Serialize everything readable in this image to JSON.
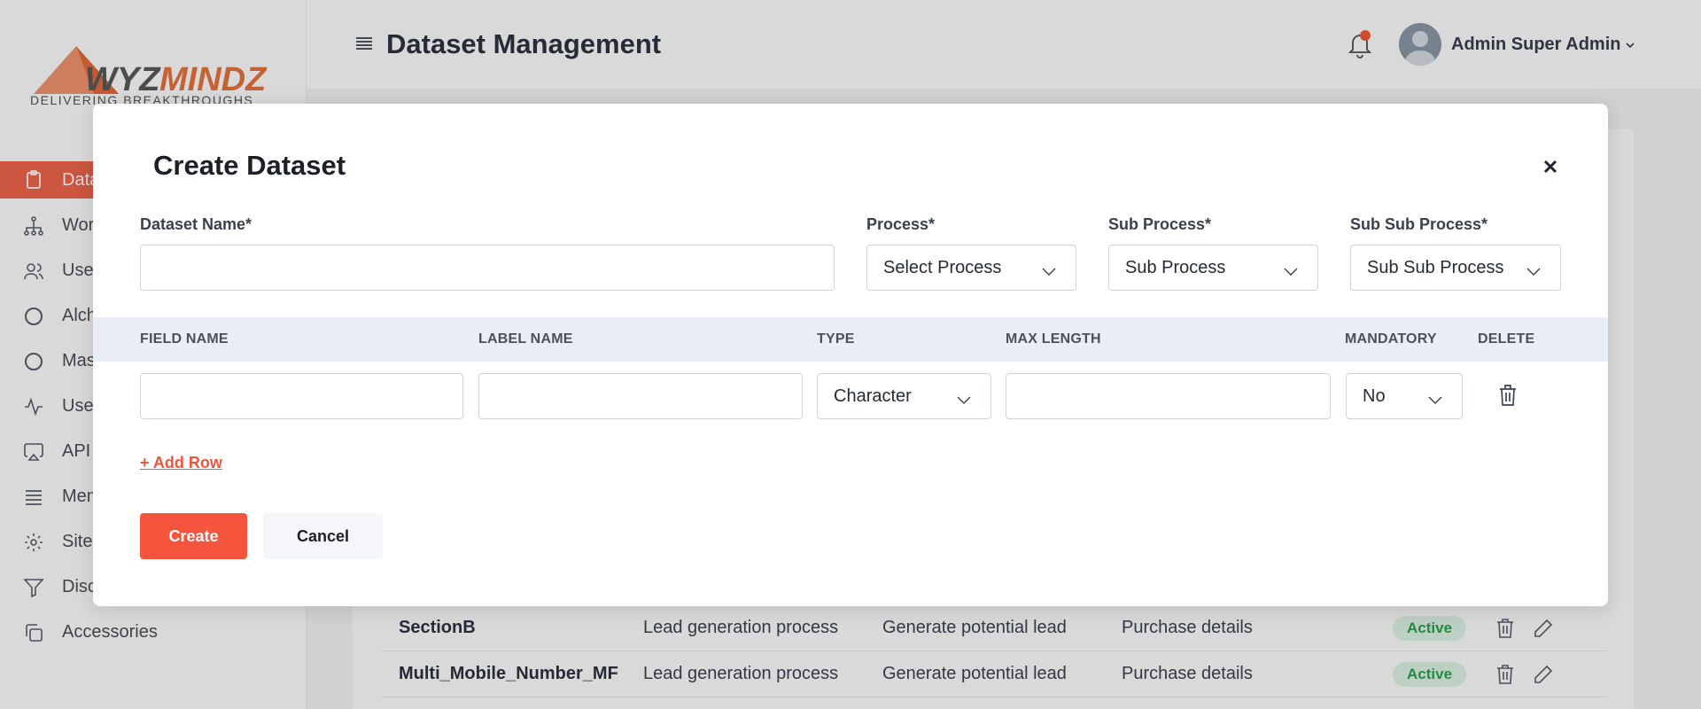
{
  "logo": {
    "wordmark_dark": "WYZ",
    "wordmark_accent": "MINDZ",
    "tagline": "DELIVERING BREAKTHROUGHS"
  },
  "sidebar": {
    "items": [
      {
        "label": "Datasets",
        "icon": "clipboard-icon",
        "active": true
      },
      {
        "label": "Workflows",
        "icon": "hierarchy-icon"
      },
      {
        "label": "Users",
        "icon": "users-icon"
      },
      {
        "label": "Alchemy",
        "icon": "circle-icon"
      },
      {
        "label": "Masters",
        "icon": "circle-icon"
      },
      {
        "label": "User Activity",
        "icon": "activity-icon"
      },
      {
        "label": "API",
        "icon": "airplay-icon"
      },
      {
        "label": "Menus",
        "icon": "list-icon"
      },
      {
        "label": "Site Settings",
        "icon": "gear-icon"
      },
      {
        "label": "Discovery",
        "icon": "filter-icon"
      },
      {
        "label": "Accessories",
        "icon": "copy-icon"
      }
    ]
  },
  "header": {
    "title": "Dataset Management",
    "user_name": "Admin Super Admin"
  },
  "background_table": {
    "rows": [
      {
        "name": "SectionB",
        "process": "Lead generation process",
        "sub_process": "Generate potential lead",
        "sub_sub_process": "Purchase details",
        "status": "Active"
      },
      {
        "name": "Multi_Mobile_Number_MF",
        "process": "Lead generation process",
        "sub_process": "Generate potential lead",
        "sub_sub_process": "Purchase details",
        "status": "Active"
      }
    ]
  },
  "modal": {
    "title": "Create Dataset",
    "fields": {
      "dataset_name_label": "Dataset Name*",
      "dataset_name_value": "",
      "process_label": "Process*",
      "process_value": "Select Process",
      "sub_process_label": "Sub Process*",
      "sub_process_value": "Sub Process",
      "sub_sub_process_label": "Sub Sub Process*",
      "sub_sub_process_value": "Sub Sub Process"
    },
    "table": {
      "headers": [
        "FIELD NAME",
        "LABEL NAME",
        "TYPE",
        "MAX LENGTH",
        "MANDATORY",
        "DELETE"
      ],
      "rows": [
        {
          "field_name": "",
          "label_name": "",
          "type": "Character",
          "max_length": "",
          "mandatory": "No"
        }
      ]
    },
    "add_row_label": "+ Add Row",
    "create_label": "Create",
    "cancel_label": "Cancel"
  },
  "colors": {
    "accent": "#f5553c",
    "active_badge_bg": "#dff5e7",
    "active_badge_text": "#2aa44f",
    "table_header_bg": "#e9eef6"
  }
}
